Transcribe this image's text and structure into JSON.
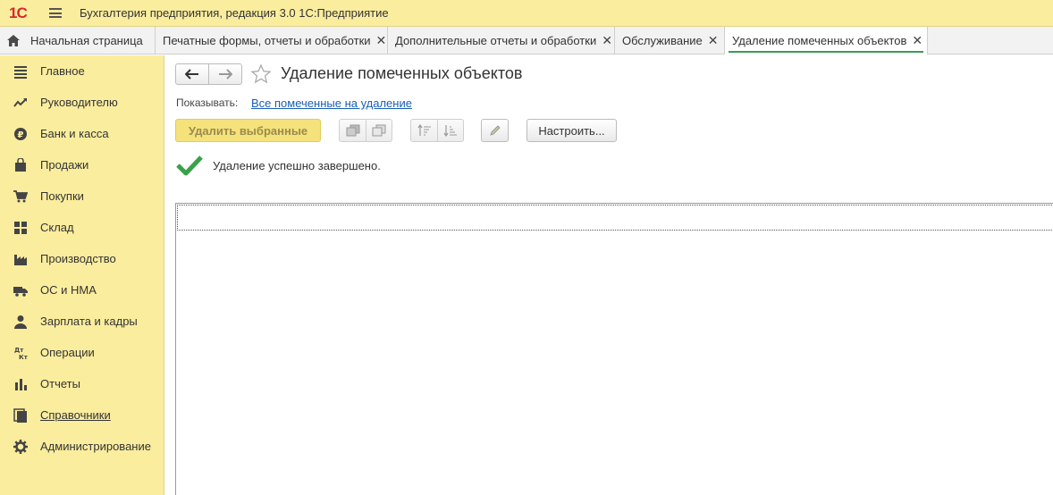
{
  "titlebar": {
    "logo": "1С",
    "app_title": "Бухгалтерия предприятия, редакция 3.0 1С:Предприятие"
  },
  "tabs": [
    {
      "label": "Начальная страница"
    },
    {
      "label": "Печатные формы, отчеты и обработки"
    },
    {
      "label": "Дополнительные отчеты и обработки"
    },
    {
      "label": "Обслуживание"
    },
    {
      "label": "Удаление помеченных объектов",
      "active": true
    }
  ],
  "sidebar": {
    "items": [
      {
        "label": "Главное",
        "icon": "menu-lines-icon"
      },
      {
        "label": "Руководителю",
        "icon": "trend-chart-icon"
      },
      {
        "label": "Банк и касса",
        "icon": "ruble-coin-icon"
      },
      {
        "label": "Продажи",
        "icon": "shopping-bag-icon"
      },
      {
        "label": "Покупки",
        "icon": "shopping-cart-icon"
      },
      {
        "label": "Склад",
        "icon": "warehouse-grid-icon"
      },
      {
        "label": "Производство",
        "icon": "factory-icon"
      },
      {
        "label": "ОС и НМА",
        "icon": "truck-icon"
      },
      {
        "label": "Зарплата и кадры",
        "icon": "person-icon"
      },
      {
        "label": "Операции",
        "icon": "debit-credit-icon"
      },
      {
        "label": "Отчеты",
        "icon": "bar-chart-icon"
      },
      {
        "label": "Справочники",
        "icon": "books-icon",
        "underlined": true
      },
      {
        "label": "Администрирование",
        "icon": "gear-icon"
      }
    ]
  },
  "page": {
    "title": "Удаление помеченных объектов",
    "show_label": "Показывать:",
    "show_link": "Все помеченные на удаление",
    "delete_button": "Удалить выбранные",
    "settings_button": "Настроить...",
    "status_text": "Удаление успешно завершено."
  },
  "colors": {
    "sidebar_bg": "#fbed9e",
    "active_tab_underline": "#3a9b57",
    "link": "#1a5fb4",
    "success_check": "#3aa14a"
  }
}
